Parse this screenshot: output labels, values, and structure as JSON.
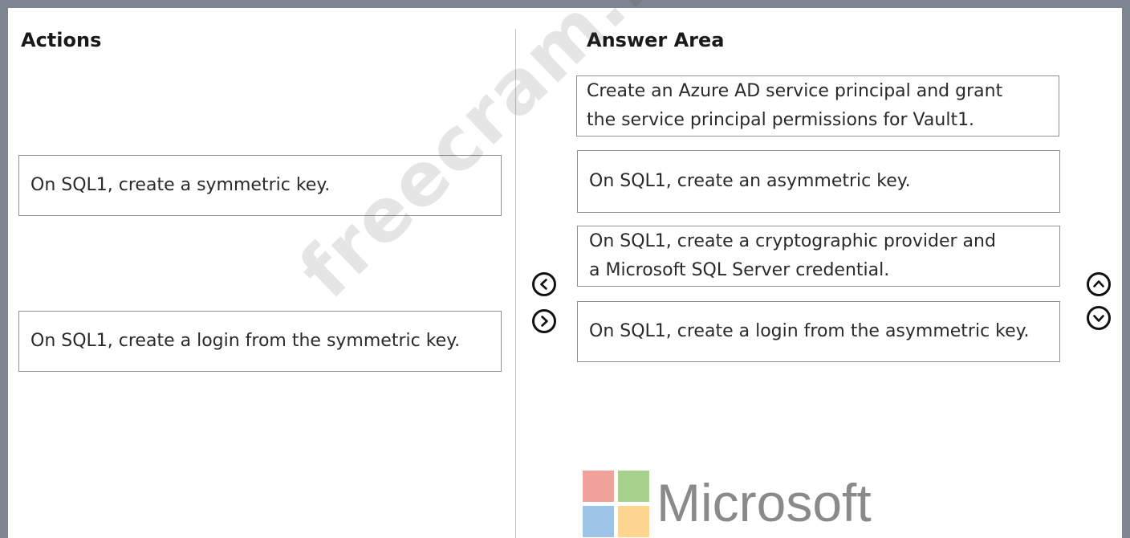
{
  "actions": {
    "heading": "Actions",
    "items": [
      {
        "label": "On SQL1, create a symmetric key."
      },
      {
        "label": "On SQL1, create a login from the symmetric key."
      }
    ]
  },
  "answer_area": {
    "heading": "Answer Area",
    "items": [
      {
        "line1": "Create an Azure AD service principal and grant",
        "line2": "the service principal permissions for Vault1."
      },
      {
        "label": "On SQL1, create an asymmetric key."
      },
      {
        "line1": "On SQL1, create a cryptographic provider and",
        "line2": "a Microsoft SQL Server credential."
      },
      {
        "label": "On SQL1, create a login from the asymmetric key."
      }
    ]
  },
  "controls": {
    "move_left": "chevron-left-icon",
    "move_right": "chevron-right-icon",
    "move_up": "chevron-up-icon",
    "move_down": "chevron-down-icon"
  },
  "watermark": "freecram.net",
  "brand": {
    "name": "Microsoft",
    "colors": [
      "#f1a29a",
      "#a9d18e",
      "#9dc3e6",
      "#ffd592"
    ]
  }
}
